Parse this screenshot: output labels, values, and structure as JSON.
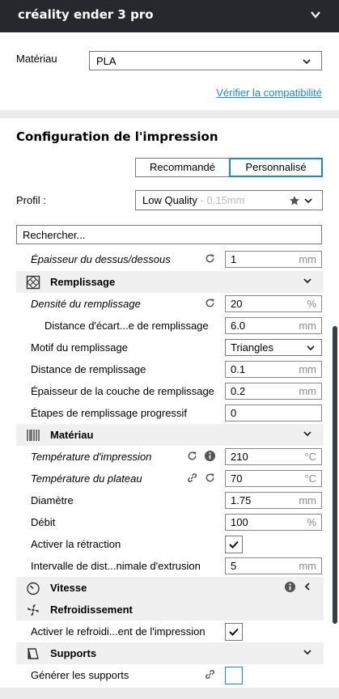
{
  "header": {
    "title": "créality ender 3 pro",
    "collapse_icon": "chevron-down-icon"
  },
  "material": {
    "label": "Matériau",
    "selected": "PLA",
    "compat_link": "Vérifier la compatibilité"
  },
  "print_setup": {
    "title": "Configuration de l'impression",
    "tabs": [
      {
        "label": "Recommandé"
      },
      {
        "label": "Personnalisé"
      }
    ],
    "profile": {
      "label": "Profil :",
      "value": "Low Quality",
      "sub": " - 0.15mm"
    },
    "search_placeholder": "Rechercher..."
  },
  "settings": [
    {
      "type": "setting",
      "label": "Épaisseur du dessus/dessous",
      "value": "1",
      "unit": "mm"
    },
    {
      "type": "category",
      "label": "Remplissage",
      "icon": "infill-icon"
    },
    {
      "type": "setting",
      "label": "Densité du remplissage",
      "value": "20",
      "unit": "%"
    },
    {
      "type": "setting",
      "label": "Distance d'écart...e de remplissage",
      "value": "6.0",
      "unit": "mm"
    },
    {
      "type": "dropdown",
      "label": "Motif du remplissage",
      "value": "Triangles"
    },
    {
      "type": "setting",
      "label": "Distance de remplissage",
      "value": "0.1",
      "unit": "mm"
    },
    {
      "type": "setting",
      "label": "Épaisseur de la couche de remplissage",
      "value": "0.2",
      "unit": "mm"
    },
    {
      "type": "setting",
      "label": "Étapes de remplissage progressif",
      "value": "0",
      "unit": ""
    },
    {
      "type": "category",
      "label": "Matériau",
      "icon": "material-icon"
    },
    {
      "type": "setting",
      "label": "Température d'impression",
      "value": "210",
      "unit": "°C"
    },
    {
      "type": "setting",
      "label": "Température du plateau",
      "value": "70",
      "unit": "°C"
    },
    {
      "type": "setting",
      "label": "Diamètre",
      "value": "1.75",
      "unit": "mm"
    },
    {
      "type": "setting",
      "label": "Débit",
      "value": "100",
      "unit": "%"
    },
    {
      "type": "checkbox",
      "label": "Activer la rétraction",
      "checked": true
    },
    {
      "type": "setting",
      "label": "Intervalle de dist...nimale d'extrusion",
      "value": "5",
      "unit": "mm"
    },
    {
      "type": "category",
      "label": "Vitesse",
      "icon": "speed-icon"
    },
    {
      "type": "category",
      "label": "Refroidissement",
      "icon": "fan-icon"
    },
    {
      "type": "checkbox",
      "label": "Activer le refroidi...ent de l'impression",
      "checked": true
    },
    {
      "type": "category",
      "label": "Supports",
      "icon": "support-icon"
    },
    {
      "type": "checkbox",
      "label": "Générer les supports",
      "checked": false
    }
  ],
  "colors": {
    "accent": "#1c8ac9",
    "header_bg": "#25292e",
    "category_bg": "#f0f0f0"
  }
}
